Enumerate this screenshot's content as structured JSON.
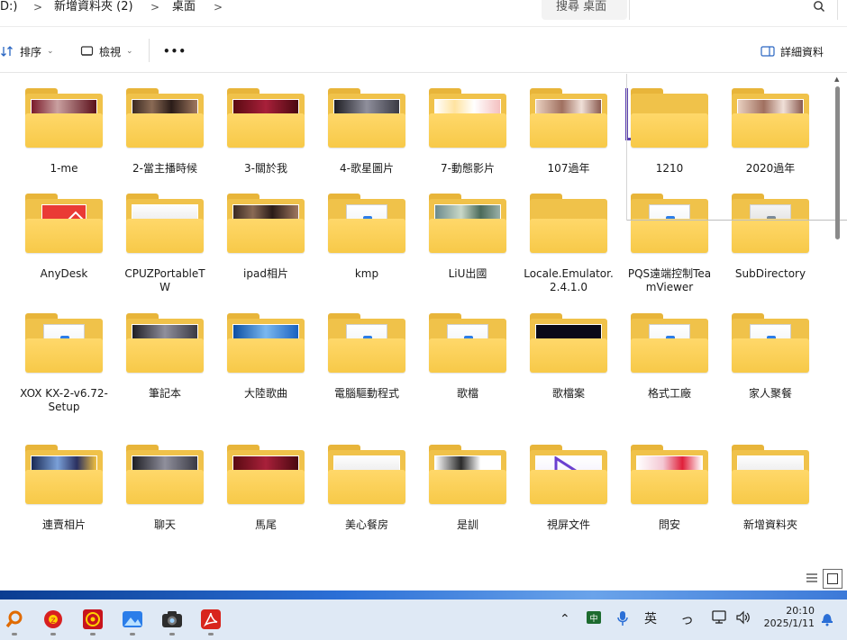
{
  "breadcrumb": {
    "drive": "D:)",
    "folder": "新增資料夾 (2)",
    "current": "桌面"
  },
  "search": {
    "placeholder": "搜尋 桌面"
  },
  "toolbar": {
    "sort_label": "排序",
    "view_label": "檢視",
    "more_label": "•••",
    "details_label": "詳細資料"
  },
  "folders": [
    {
      "name": "1-me",
      "thumb": "photo-red"
    },
    {
      "name": "2-當主播時候",
      "thumb": "photo-stage"
    },
    {
      "name": "3-關於我",
      "thumb": "photo-red-dark"
    },
    {
      "name": "4-歌星圖片",
      "thumb": "photo-face"
    },
    {
      "name": "7-動態影片",
      "thumb": "cartoon"
    },
    {
      "name": "107過年",
      "thumb": "photo-people"
    },
    {
      "name": "1210",
      "thumb": "selected"
    },
    {
      "name": "2020過年",
      "thumb": "photo-people"
    },
    {
      "name": "AnyDesk",
      "thumb": "anydesk"
    },
    {
      "name": "CPUZPortableTW",
      "thumb": "document"
    },
    {
      "name": "ipad相片",
      "thumb": "photo-stage"
    },
    {
      "name": "kmp",
      "thumb": "blank-doc"
    },
    {
      "name": "LiU出國",
      "thumb": "photo-landscape"
    },
    {
      "name": "Locale.Emulator.2.4.1.0",
      "thumb": "empty"
    },
    {
      "name": "PQS遠端控制TeamViewer",
      "thumb": "blank-doc"
    },
    {
      "name": "SubDirectory",
      "thumb": "gear"
    },
    {
      "name": "XOX KX-2-v6.72-Setup",
      "thumb": "blank-doc"
    },
    {
      "name": "筆記本",
      "thumb": "photo-face"
    },
    {
      "name": "大陸歌曲",
      "thumb": "desktop"
    },
    {
      "name": "電腦驅動程式",
      "thumb": "blank-doc"
    },
    {
      "name": "歌檔",
      "thumb": "blank-doc"
    },
    {
      "name": "歌檔案",
      "thumb": "dark"
    },
    {
      "name": "格式工廠",
      "thumb": "blank-doc"
    },
    {
      "name": "家人聚餐",
      "thumb": "blank-doc"
    },
    {
      "name": "連賣相片",
      "thumb": "photo-city"
    },
    {
      "name": "聊天",
      "thumb": "photo-face"
    },
    {
      "name": "馬尾",
      "thumb": "photo-red-dark"
    },
    {
      "name": "美心餐房",
      "thumb": "document"
    },
    {
      "name": "是訓",
      "thumb": "cartoon-face"
    },
    {
      "name": "視屏文件",
      "thumb": "play"
    },
    {
      "name": "問安",
      "thumb": "flowers"
    },
    {
      "name": "新增資料夾",
      "thumb": "document"
    }
  ],
  "taskbar": {
    "ime_label": "英",
    "time": "20:10",
    "date": "2025/1/11",
    "accent": "#2b6fd6"
  }
}
